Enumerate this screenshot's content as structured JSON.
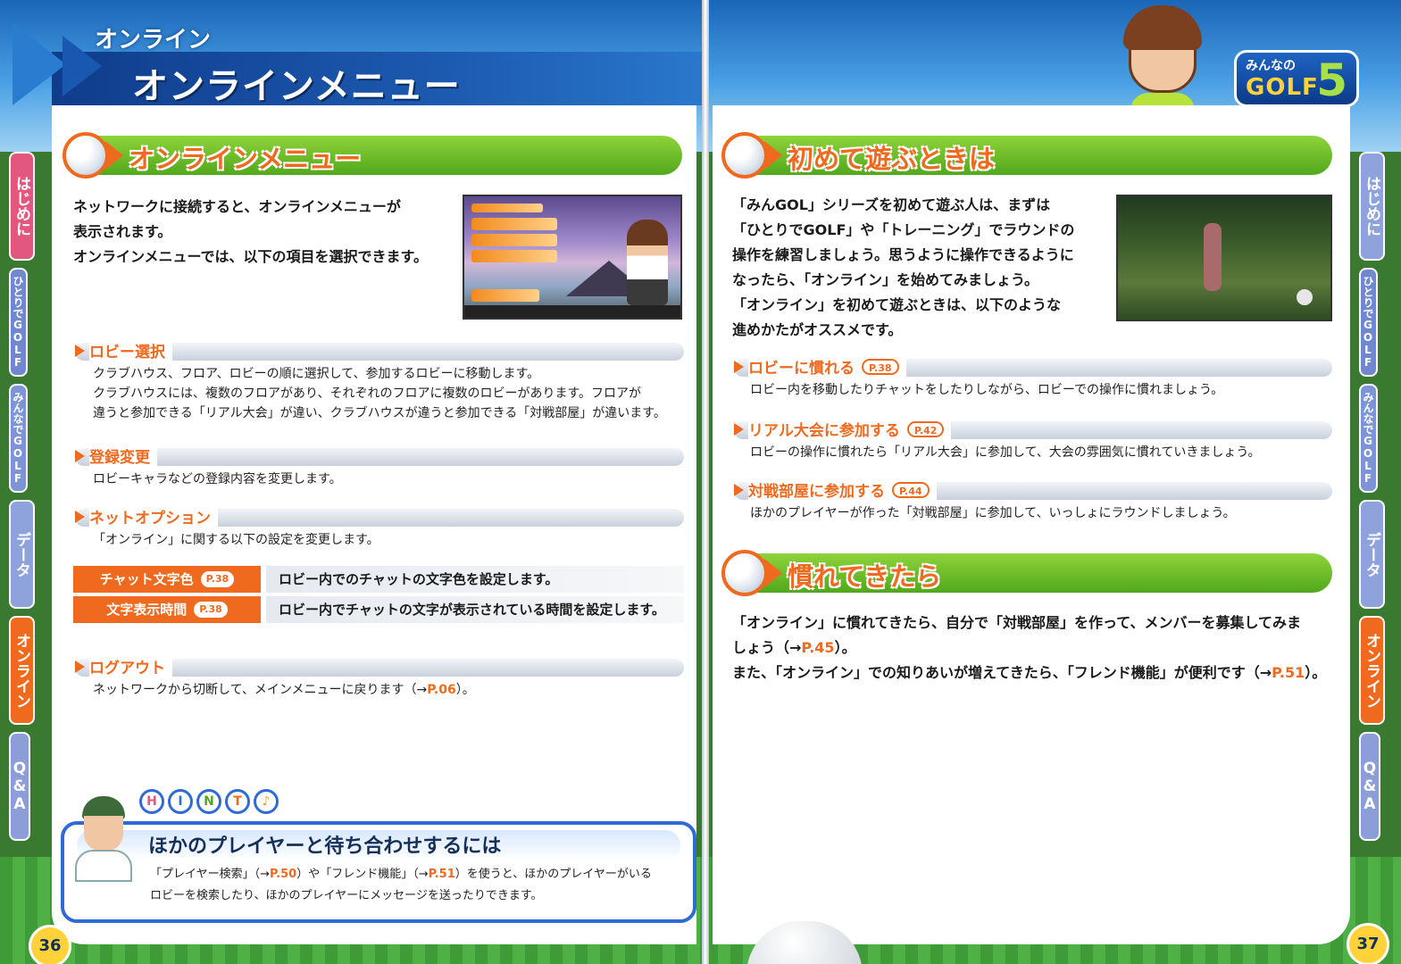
{
  "header": {
    "section_small": "オンライン",
    "section_big": "オンラインメニュー",
    "logo_top": "みんなの",
    "logo_mid": "GOLF",
    "logo_num": "5"
  },
  "tabs": [
    {
      "label": "はじめに"
    },
    {
      "label": "ひとりでGOLF"
    },
    {
      "label": "みんなでGOLF"
    },
    {
      "label": "データ"
    },
    {
      "label": "オンライン"
    },
    {
      "label": "Q&A"
    }
  ],
  "left": {
    "title": "オンラインメニュー",
    "intro": [
      "ネットワークに接続すると、オンラインメニューが",
      "表示されます。",
      "オンラインメニューでは、以下の項目を選択できます。"
    ],
    "items": [
      {
        "label": "ロビー選択",
        "lines": [
          "クラブハウス、フロア、ロビーの順に選択して、参加するロビーに移動します。",
          "クラブハウスには、複数のフロアがあり、それぞれのフロアに複数のロビーがあります。フロアが",
          "違うと参加できる「リアル大会」が違い、クラブハウスが違うと参加できる「対戦部屋」が違います。"
        ]
      },
      {
        "label": "登録変更",
        "lines": [
          "ロビーキャラなどの登録内容を変更します。"
        ]
      },
      {
        "label": "ネットオプション",
        "lines": [
          "「オンライン」に関する以下の設定を変更します。"
        ]
      },
      {
        "label": "ログアウト",
        "text": "ネットワークから切断して、メインメニューに戻ります（→",
        "ref": "P.06",
        "text_end": "）。"
      }
    ],
    "options": [
      {
        "key": "チャット文字色",
        "ref": "P.38",
        "value": "ロビー内でのチャットの文字色を設定します。"
      },
      {
        "key": "文字表示時間",
        "ref": "P.38",
        "value": "ロビー内でチャットの文字が表示されている時間を設定します。"
      }
    ],
    "hint": {
      "letters": [
        "H",
        "I",
        "N",
        "T",
        "♪"
      ],
      "title": "ほかのプレイヤーと待ち合わせするには",
      "t1": "「プレイヤー検索」（→",
      "r1": "P.50",
      "t2": "）や「フレンド機能」（→",
      "r2": "P.51",
      "t3": "）を使うと、ほかのプレイヤーがいる",
      "t4": "ロビーを検索したり、ほかのプレイヤーにメッセージを送ったりできます。"
    },
    "page_number": "36"
  },
  "right": {
    "title1": "初めて遊ぶときは",
    "intro": [
      "「みんGOL」シリーズを初めて遊ぶ人は、まずは",
      "「ひとりでGOLF」や「トレーニング」でラウンドの",
      "操作を練習しましょう。思うように操作できるように",
      "なったら、「オンライン」を始めてみましょう。",
      "「オンライン」を初めて遊ぶときは、以下のような",
      "進めかたがオススメです。"
    ],
    "steps": [
      {
        "label": "ロビーに慣れる",
        "ref": "P.38",
        "text": "ロビー内を移動したりチャットをしたりしながら、ロビーでの操作に慣れましょう。"
      },
      {
        "label": "リアル大会に参加する",
        "ref": "P.42",
        "text": "ロビーの操作に慣れたら「リアル大会」に参加して、大会の雰囲気に慣れていきましょう。"
      },
      {
        "label": "対戦部屋に参加する",
        "ref": "P.44",
        "text": "ほかのプレイヤーが作った「対戦部屋」に参加して、いっしょにラウンドしましょう。"
      }
    ],
    "title2": "慣れてきたら",
    "outro": {
      "a1": "「オンライン」に慣れてきたら、自分で「対戦部屋」を作って、メンバーを募集してみま",
      "a2": "しょう（→",
      "ra": "P.45",
      "a3": "）。",
      "b1": "また、「オンライン」での知りあいが増えてきたら、「フレンド機能」が便利です（→",
      "rb": "P.51",
      "b2": "）。"
    },
    "page_number": "37"
  },
  "colors": {
    "accent": "#ef6a1e",
    "green": "#52a81c",
    "blue": "#1c5ab0"
  }
}
